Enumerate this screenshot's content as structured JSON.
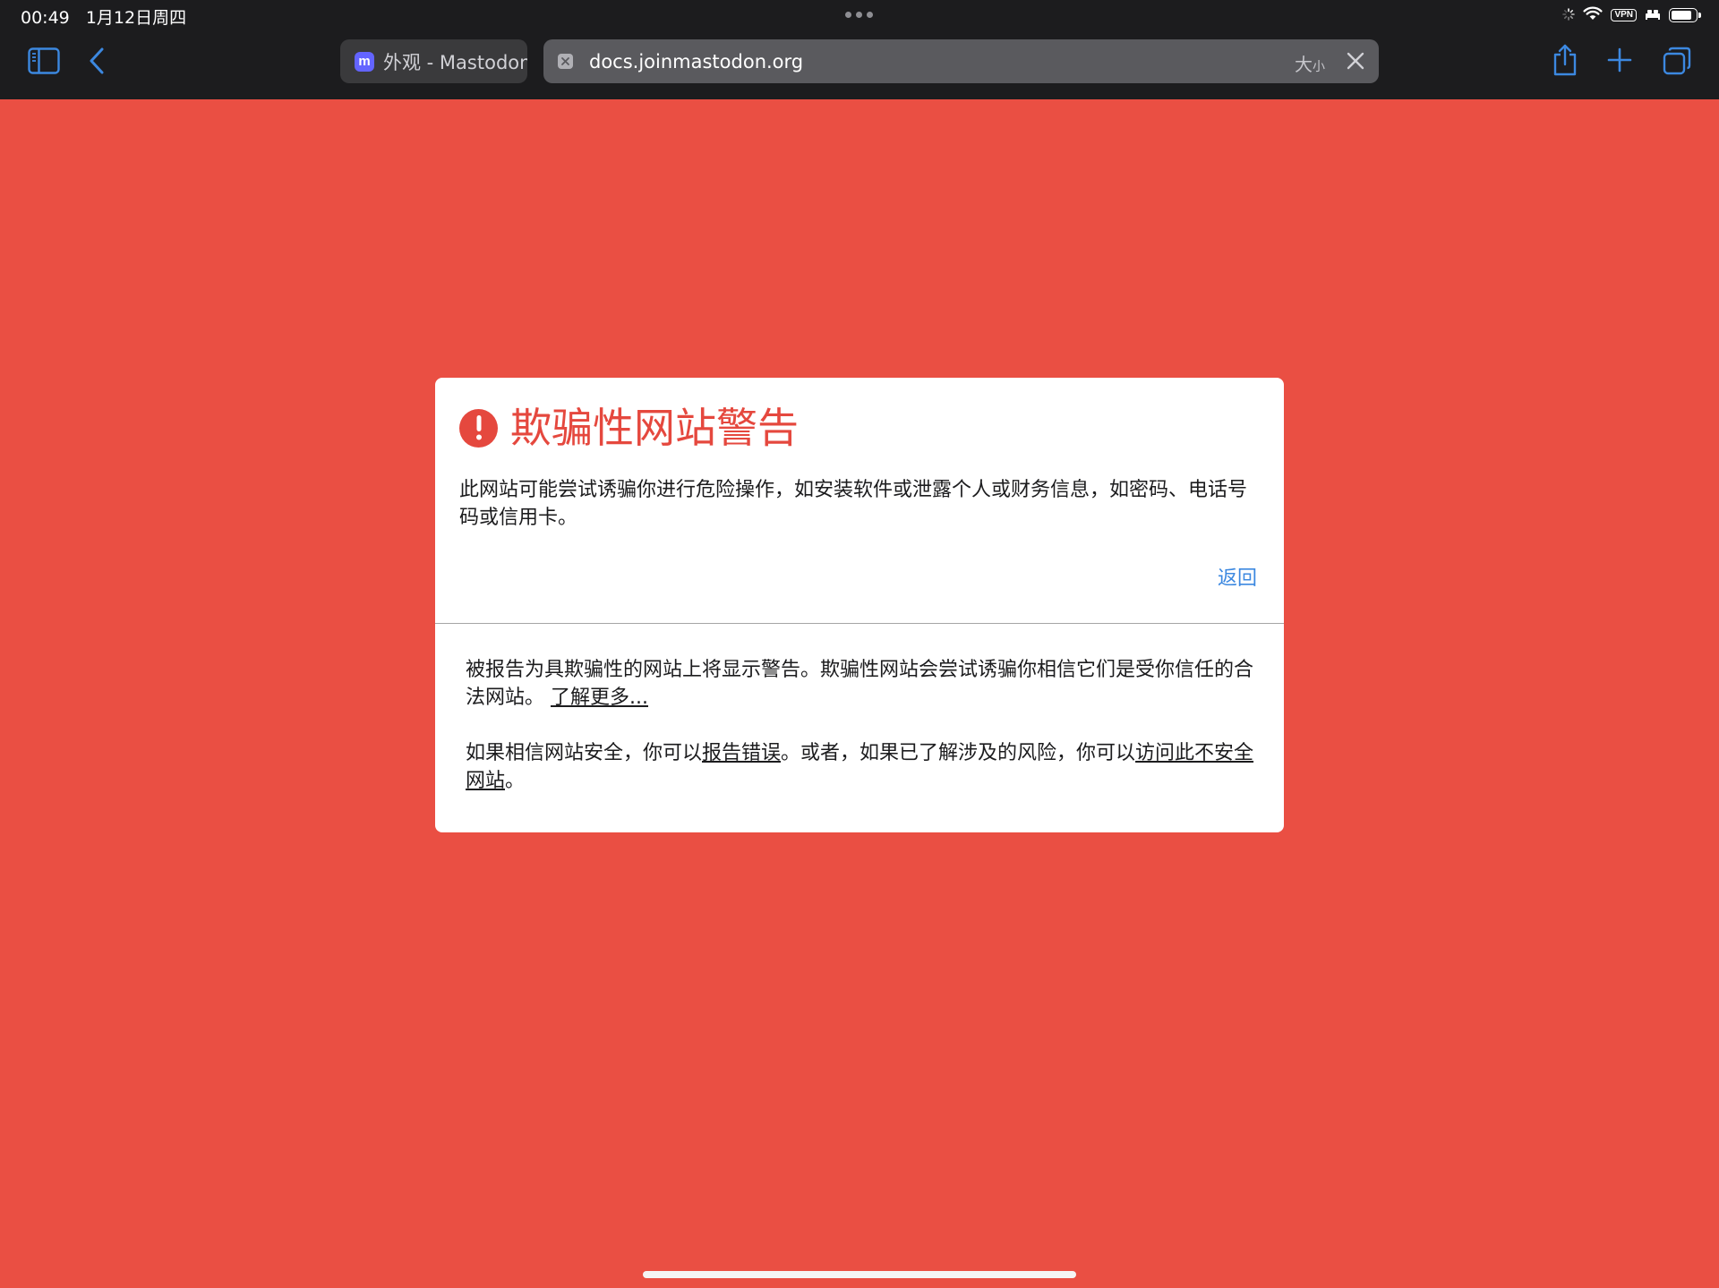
{
  "status_bar": {
    "time": "00:49",
    "date": "1月12日周四",
    "vpn_label": "VPN",
    "icons": [
      "loading-icon",
      "wifi-icon",
      "vpn-icon",
      "sleep-icon",
      "battery-icon"
    ],
    "battery_level": 0.85
  },
  "toolbar": {
    "icons": [
      "sidebar-icon",
      "back-chevron-icon",
      "share-icon",
      "plus-icon",
      "tabs-overview-icon"
    ],
    "accent_color": "#3c88e0",
    "tabs": [
      {
        "title": "外观 - Mastodon",
        "active": false,
        "favicon": "mastodon-icon"
      },
      {
        "title": "docs.joinmastodon.org",
        "active": true,
        "favicon": "blocked-site-icon"
      }
    ],
    "reader_size_big": "大",
    "reader_size_small": "小"
  },
  "warning": {
    "title": "欺骗性网站警告",
    "description": "此网站可能尝试诱骗你进行危险操作，如安装软件或泄露个人或财务信息，如密码、电话号码或信用卡。",
    "back_label": "返回",
    "details": {
      "para1_text": "被报告为具欺骗性的网站上将显示警告。欺骗性网站会尝试诱骗你相信它们是受你信任的合法网站。",
      "learn_more": "了解更多...",
      "para2_prefix": "如果相信网站安全，你可以",
      "report_error": "报告错误",
      "para2_middle": "。或者，如果已了解涉及的风险，你可以",
      "visit_unsafe": "访问此不安全网站",
      "para2_suffix": "。"
    },
    "colors": {
      "background": "#ea4f43",
      "title": "#e5483e",
      "link": "#3c88e0"
    }
  }
}
